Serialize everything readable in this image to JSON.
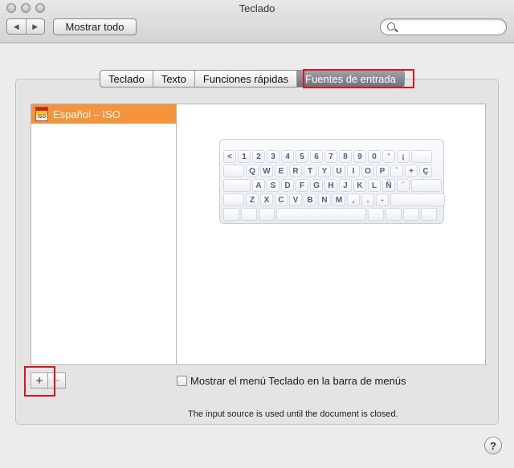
{
  "window": {
    "title": "Teclado"
  },
  "toolbar": {
    "back_icon": "◀",
    "forward_icon": "▶",
    "show_all_label": "Mostrar todo",
    "search_value": ""
  },
  "tabs": [
    {
      "label": "Teclado",
      "active": false
    },
    {
      "label": "Texto",
      "active": false
    },
    {
      "label": "Funciones rápidas",
      "active": false
    },
    {
      "label": "Fuentes de entrada",
      "active": true
    }
  ],
  "input_sources": [
    {
      "label": "Español – ISO",
      "selected": true,
      "flag_text": "ISO"
    }
  ],
  "keyboard_layout": {
    "rows": [
      [
        "<",
        "1",
        "2",
        "3",
        "4",
        "5",
        "6",
        "7",
        "8",
        "9",
        "0",
        "'",
        "¡",
        ""
      ],
      [
        "",
        "Q",
        "W",
        "E",
        "R",
        "T",
        "Y",
        "U",
        "I",
        "O",
        "P",
        "`",
        "+",
        "Ç"
      ],
      [
        "",
        "A",
        "S",
        "D",
        "F",
        "G",
        "H",
        "J",
        "K",
        "L",
        "Ñ",
        "´",
        ""
      ],
      [
        "",
        "Z",
        "X",
        "C",
        "V",
        "B",
        "N",
        "M",
        ",",
        ".",
        "-",
        ""
      ],
      [
        "",
        "",
        "",
        "",
        "",
        "",
        "",
        ""
      ]
    ]
  },
  "controls": {
    "add_label": "+",
    "remove_label": "−",
    "show_menu_label": "Mostrar el menú Teclado en la barra de menús",
    "show_menu_checked": false,
    "info_text": "The input source is used until the document is closed.",
    "help_label": "?"
  },
  "colors": {
    "selection": "#f5943c",
    "highlight": "#e0141b",
    "key_text": "#4a5f90"
  }
}
